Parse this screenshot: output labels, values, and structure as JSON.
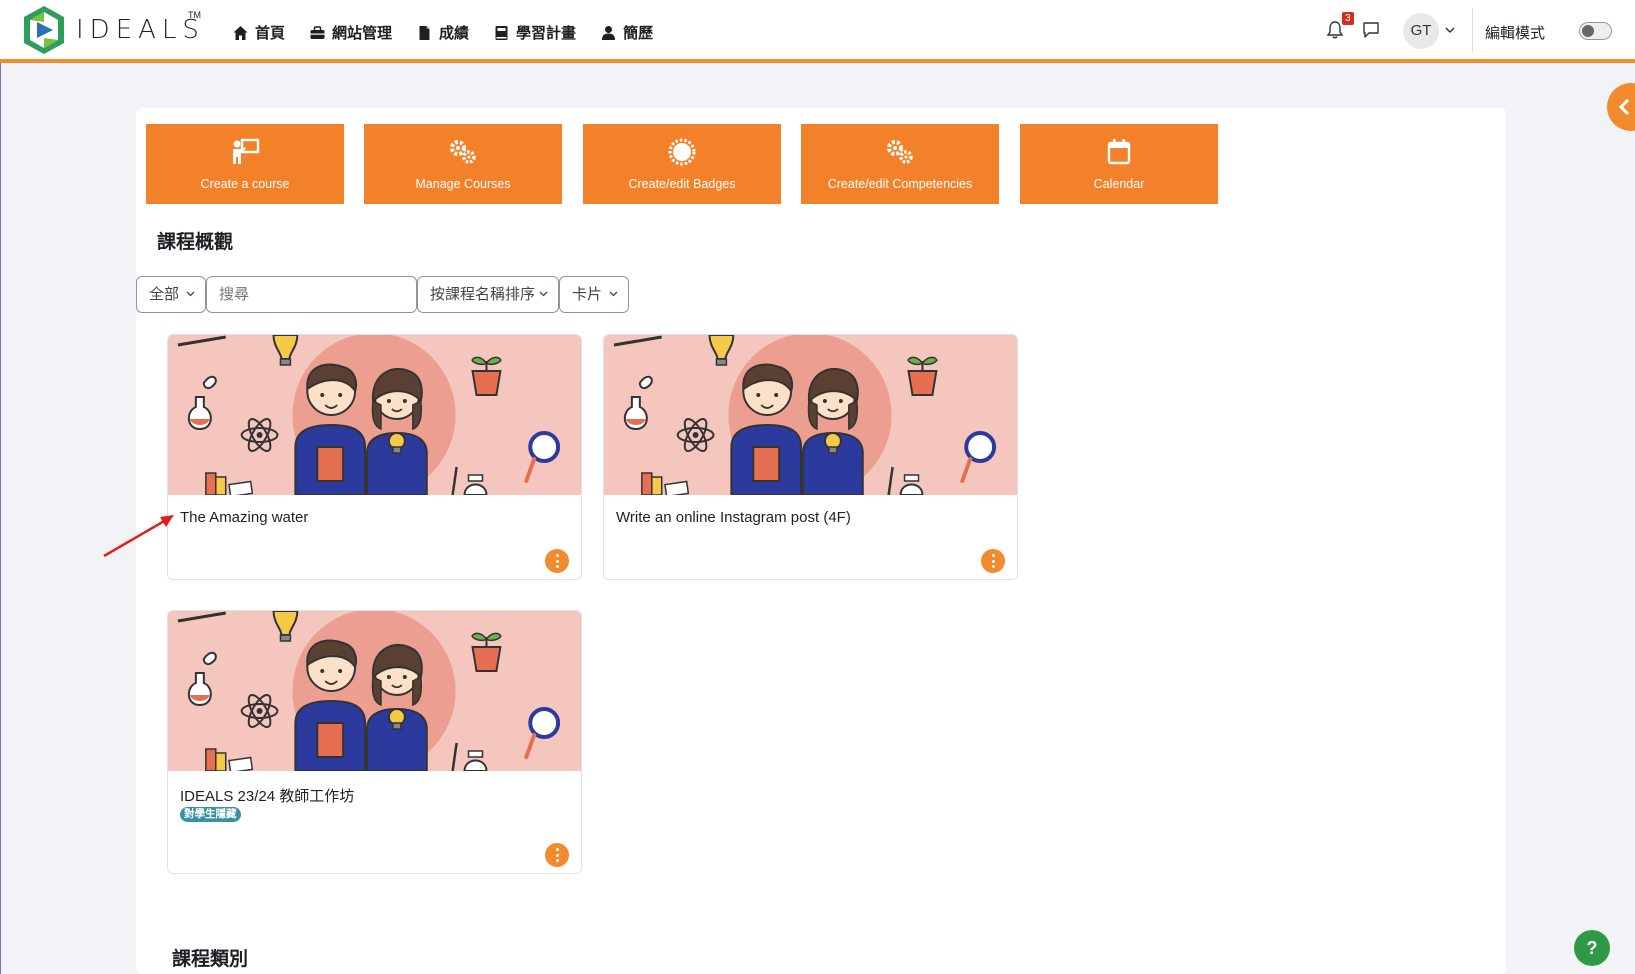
{
  "navbar": {
    "logo_text": "IDEALS",
    "logo_tm": "TM",
    "items": [
      {
        "label": "首頁",
        "icon": "home-icon"
      },
      {
        "label": "網站管理",
        "icon": "admin-icon"
      },
      {
        "label": "成績",
        "icon": "grades-icon"
      },
      {
        "label": "學習計畫",
        "icon": "learning-plan-icon"
      },
      {
        "label": "簡歷",
        "icon": "profile-icon"
      }
    ],
    "notification_count": "3",
    "user_initials": "GT",
    "edit_mode_label": "編輯模式"
  },
  "quick_actions": [
    {
      "label": "Create a course",
      "icon": "teacher-board-icon"
    },
    {
      "label": "Manage Courses",
      "icon": "cogs-icon"
    },
    {
      "label": "Create/edit Badges",
      "icon": "badge-icon"
    },
    {
      "label": "Create/edit Competencies",
      "icon": "cogs-icon"
    },
    {
      "label": "Calendar",
      "icon": "calendar-icon"
    }
  ],
  "course_overview": {
    "title": "課程概觀",
    "filter_label": "全部",
    "search_placeholder": "搜尋",
    "sort_label": "按課程名稱排序",
    "view_label": "卡片"
  },
  "courses": [
    {
      "name": "The Amazing water",
      "badge": ""
    },
    {
      "name": "Write an online Instagram post (4F)",
      "badge": ""
    },
    {
      "name": "IDEALS 23/24 教師工作坊",
      "badge": "對學生隱藏"
    }
  ],
  "course_categories": {
    "title": "課程類別"
  },
  "help_label": "?",
  "colors": {
    "accent": "#f28a2e",
    "quick_action": "#f2812a",
    "hidden_badge": "#3a8fa2",
    "help": "#2e9a45"
  }
}
